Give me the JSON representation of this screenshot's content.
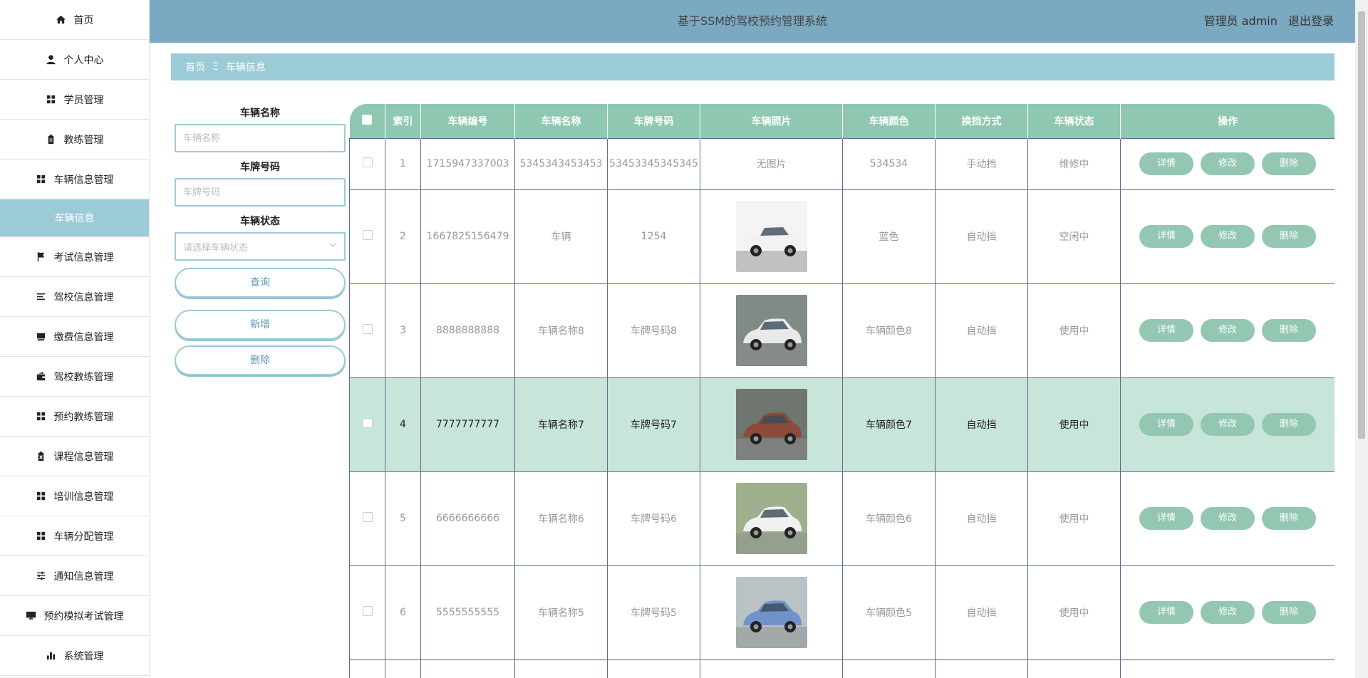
{
  "sidebar": {
    "items": [
      {
        "label": "首页",
        "icon": "home-icon"
      },
      {
        "label": "个人中心",
        "icon": "user-icon"
      },
      {
        "label": "学员管理",
        "icon": "grid-icon"
      },
      {
        "label": "教练管理",
        "icon": "clipboard-icon"
      },
      {
        "label": "车辆信息管理",
        "icon": "grid-icon"
      },
      {
        "label": "车辆信息",
        "icon": "",
        "active": true
      },
      {
        "label": "考试信息管理",
        "icon": "flag-icon"
      },
      {
        "label": "驾校信息管理",
        "icon": "list-icon"
      },
      {
        "label": "缴费信息管理",
        "icon": "book-icon"
      },
      {
        "label": "驾校教练管理",
        "icon": "wallet-icon"
      },
      {
        "label": "预约教练管理",
        "icon": "grid-icon"
      },
      {
        "label": "课程信息管理",
        "icon": "clipboard-x-icon"
      },
      {
        "label": "培训信息管理",
        "icon": "grid-icon"
      },
      {
        "label": "车辆分配管理",
        "icon": "grid-icon"
      },
      {
        "label": "通知信息管理",
        "icon": "sliders-icon"
      },
      {
        "label": "预约模拟考试管理",
        "icon": "monitor-icon"
      },
      {
        "label": "系统管理",
        "icon": "bar-chart-icon"
      }
    ]
  },
  "header": {
    "title": "基于SSM的驾校预约管理系统",
    "user": "管理员 admin",
    "logout": "退出登录"
  },
  "breadcrumb": {
    "home": "首页",
    "separator": "Ξ",
    "current": "车辆信息"
  },
  "search": {
    "name_label": "车辆名称",
    "name_placeholder": "车辆名称",
    "plate_label": "车牌号码",
    "plate_placeholder": "车牌号码",
    "status_label": "车辆状态",
    "status_placeholder": "请选择车辆状态",
    "query_btn": "查询",
    "add_btn": "新增",
    "delete_btn": "删除"
  },
  "table": {
    "columns": [
      "索引",
      "车辆编号",
      "车辆名称",
      "车牌号码",
      "车辆照片",
      "车辆颜色",
      "换挡方式",
      "车辆状态",
      "操作"
    ],
    "actions": {
      "detail": "详情",
      "edit": "修改",
      "delete": "删除"
    },
    "rows": [
      {
        "index": "1",
        "code": "1715947337003",
        "name": "5345343453453",
        "plate": "53453345345345",
        "photo": "无图片",
        "color": "534534",
        "gear": "手动挡",
        "status": "维修中"
      },
      {
        "index": "2",
        "code": "1667825156479",
        "name": "车辆",
        "plate": "1254",
        "photo": "",
        "color": "蓝色",
        "gear": "自动挡",
        "status": "空闲中"
      },
      {
        "index": "3",
        "code": "8888888888",
        "name": "车辆名称8",
        "plate": "车牌号码8",
        "photo": "",
        "color": "车辆颜色8",
        "gear": "自动挡",
        "status": "使用中"
      },
      {
        "index": "4",
        "code": "7777777777",
        "name": "车辆名称7",
        "plate": "车牌号码7",
        "photo": "",
        "color": "车辆颜色7",
        "gear": "自动挡",
        "status": "使用中"
      },
      {
        "index": "5",
        "code": "6666666666",
        "name": "车辆名称6",
        "plate": "车牌号码6",
        "photo": "",
        "color": "车辆颜色6",
        "gear": "自动挡",
        "status": "使用中"
      },
      {
        "index": "6",
        "code": "5555555555",
        "name": "车辆名称5",
        "plate": "车牌号码5",
        "photo": "",
        "color": "车辆颜色5",
        "gear": "自动挡",
        "status": "使用中"
      }
    ]
  },
  "colors": {
    "header_bg": "#7ba9c1",
    "breadcrumb_bg": "#9ccbd8",
    "table_head_bg": "#8ec8b1",
    "row_highlight": "#c8e5da",
    "action_btn": "#93c7b2"
  }
}
